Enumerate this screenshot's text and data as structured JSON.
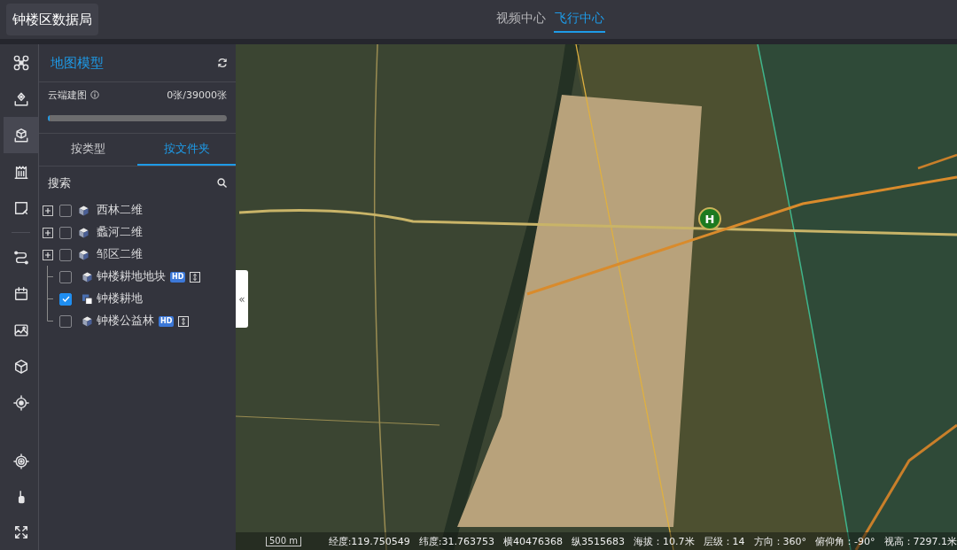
{
  "header": {
    "title": "钟楼区数据局",
    "tabs": [
      {
        "label": "视频中心",
        "selected": false
      },
      {
        "label": "飞行中心",
        "selected": true
      }
    ]
  },
  "sidebar": {
    "top_tools": [
      {
        "selected": false
      },
      {
        "selected": false
      },
      {
        "selected": true
      },
      {
        "selected": false
      },
      {
        "selected": false
      }
    ],
    "middle_tools": [
      {
        "selected": false
      },
      {
        "selected": false
      },
      {
        "selected": false
      },
      {
        "selected": false
      },
      {
        "selected": false
      }
    ],
    "bottom_tools": [
      {
        "selected": false
      },
      {
        "selected": false
      },
      {
        "selected": false
      }
    ]
  },
  "panel": {
    "title": "地图模型",
    "cloud_mapping": {
      "label": "云端建图",
      "count": "0张/39000张",
      "level": 0
    },
    "tabs": [
      {
        "label": "按类型",
        "selected": false
      },
      {
        "label": "按文件夹",
        "selected": true
      }
    ],
    "search": {
      "placeholder": "搜索"
    },
    "layers": [
      {
        "name": "西林二维",
        "kind": "group",
        "expanded": false,
        "checked": false,
        "adjustable": false
      },
      {
        "name": "蠡河二维",
        "kind": "group",
        "expanded": false,
        "checked": false,
        "adjustable": false
      },
      {
        "name": "邹区二维",
        "kind": "group",
        "expanded": false,
        "checked": false,
        "adjustable": false
      },
      {
        "name": "钟楼耕地地块",
        "kind": "model",
        "checked": false,
        "badge": "HD",
        "adjustable": true
      },
      {
        "name": "钟楼耕地",
        "kind": "imagery",
        "checked": true,
        "adjustable": false
      },
      {
        "name": "钟楼公益林",
        "kind": "model",
        "checked": false,
        "badge": "HD",
        "adjustable": true
      }
    ]
  },
  "map": {
    "collapse_handle": "«",
    "marker": "H",
    "scale": "500 m",
    "status": [
      "经度:119.750549",
      "纬度:31.763753",
      "横40476368",
      "纵3515683",
      "海拔：10.7米",
      "层级：14",
      "方向：360°",
      "俯仰角：-90°",
      "视高：7297.1米"
    ]
  }
}
